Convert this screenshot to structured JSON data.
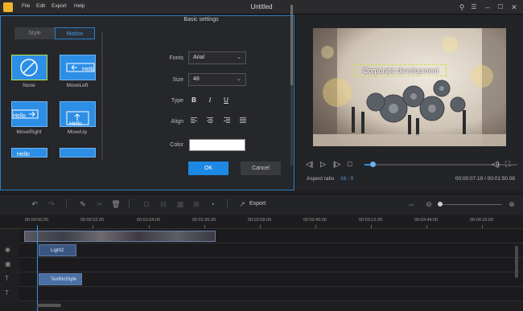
{
  "app": {
    "title": "Untitled",
    "menu": [
      "File",
      "Edit",
      "Export",
      "Help"
    ]
  },
  "editor": {
    "tabs": {
      "style": "Style",
      "motion": "Motion"
    },
    "motions": [
      {
        "label": "None"
      },
      {
        "label": "MoveLeft"
      },
      {
        "label": "MoveRight"
      },
      {
        "label": "MoveUp"
      }
    ],
    "thumb_text": "Hello",
    "basic_settings": {
      "title": "Basic settings",
      "fonts_label": "Fonts",
      "font_value": "Arial",
      "size_label": "Size",
      "size_value": "48",
      "type_label": "Type",
      "type_buttons": [
        "B",
        "I",
        "U"
      ],
      "align_label": "Align",
      "color_label": "Color",
      "color_value": "#ffffff"
    },
    "ok_label": "OK",
    "cancel_label": "Cancel"
  },
  "preview": {
    "caption": "Corporate development",
    "aspect_label": "Aspect ratio",
    "aspect_value": "16 : 9",
    "time": "00:00:07.19 / 00:01:50.08",
    "progress": 0.05
  },
  "toolbar": {
    "export_label": "Export"
  },
  "timeline": {
    "ruler": [
      "00:00:00.00",
      "00:00:32.00",
      "00:01:04.00",
      "00:01:36.00",
      "00:02:08.00",
      "00:02:40.00",
      "00:03:12.00",
      "00:03:44.00",
      "00:04:16.00"
    ],
    "clips": {
      "light": "Light2",
      "text": "TextNoStyle"
    }
  },
  "colors": {
    "accent": "#1e88e5",
    "panel": "#26272a",
    "background": "#1f1f22"
  }
}
